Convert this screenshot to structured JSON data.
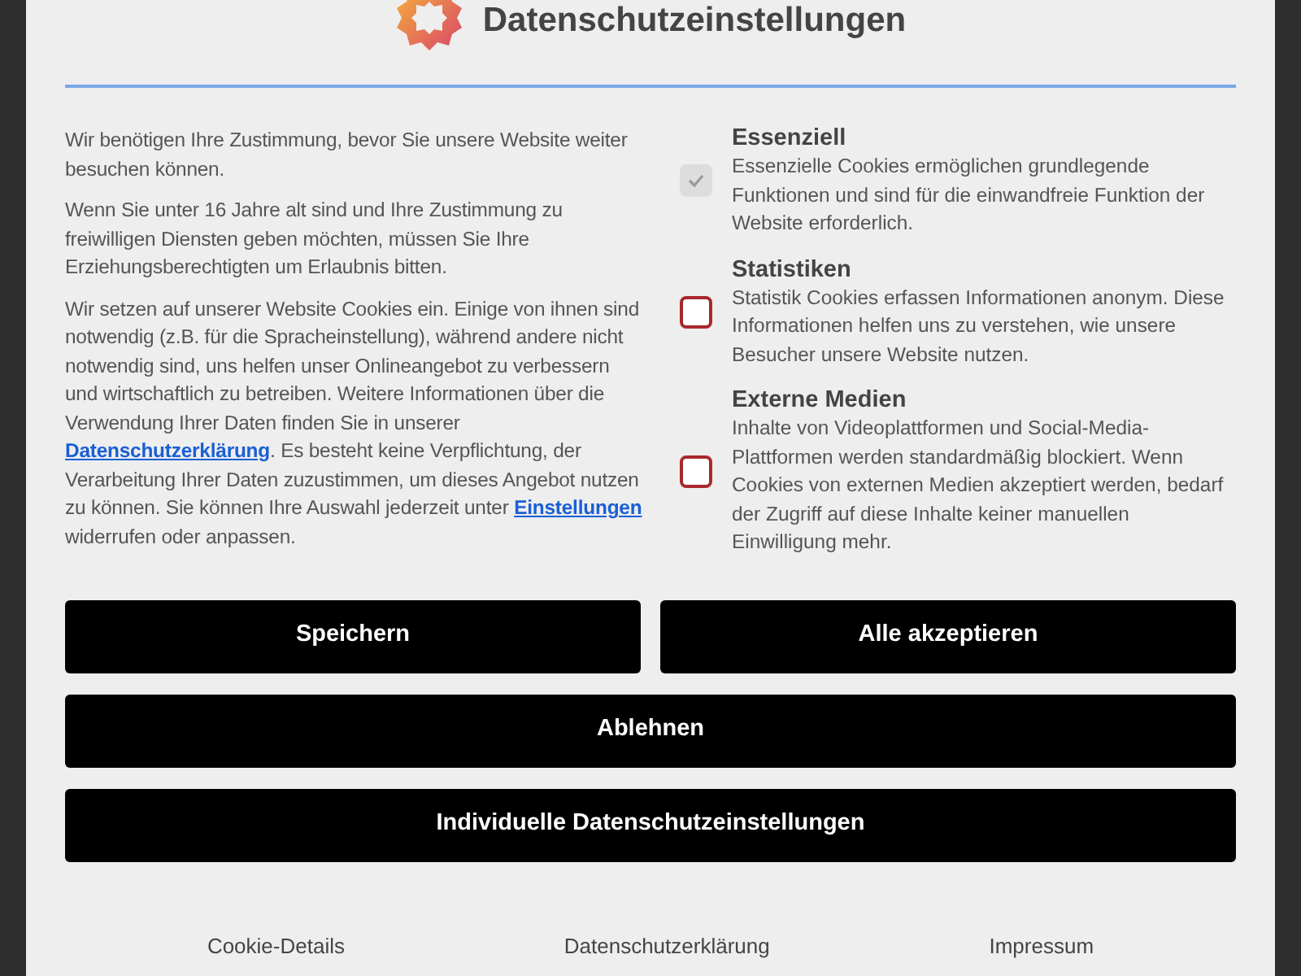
{
  "dialog": {
    "title": "Datenschutzeinstellungen",
    "intro": [
      "Wir benötigen Ihre Zustimmung, bevor Sie unsere Website weiter besuchen können.",
      "Wenn Sie unter 16 Jahre alt sind und Ihre Zustimmung zu freiwilligen Diensten geben möchten, müssen Sie Ihre Erziehungsberechtigten um Erlaubnis bitten."
    ],
    "notice": {
      "part_1": "Wir setzen auf unserer Website Cookies ein. Einige von ihnen sind notwendig (z.B. für die Spracheinstellung), während andere nicht notwendig sind, uns helfen unser Onlineangebot zu verbessern und wirtschaftlich zu betreiben. Weitere Informationen über die Verwendung Ihrer Daten finden Sie in unserer",
      "link_1": "Datenschutzerklärung",
      "part_2": ". Es besteht keine Verpflichtung, der Verarbeitung Ihrer Daten zuzustimmen, um dieses Angebot nutzen zu können. Sie können Ihre Auswahl jederzeit unter",
      "link_2": "Einstellungen",
      "part_3": "widerrufen oder anpassen."
    },
    "categories": [
      {
        "title": "Essenziell",
        "description": "Essenzielle Cookies ermöglichen grundlegende Funktionen und sind für die einwandfreie Funktion der Website erforderlich.",
        "checked": true,
        "disabled": true
      },
      {
        "title": "Statistiken",
        "description": "Statistik Cookies erfassen Informationen anonym. Diese Informationen helfen uns zu verstehen, wie unsere Besucher unsere Website nutzen.",
        "checked": false,
        "disabled": false
      },
      {
        "title": "Externe Medien",
        "description": "Inhalte von Videoplattformen und Social-Media-Plattformen werden standardmäßig blockiert. Wenn Cookies von externen Medien akzeptiert werden, bedarf der Zugriff auf diese Inhalte keiner manuellen Einwilligung mehr.",
        "checked": false,
        "disabled": false
      }
    ],
    "buttons": [
      "Speichern",
      "Alle akzeptieren",
      "Ablehnen",
      "Individuelle Datenschutzeinstellungen"
    ],
    "footer_links": [
      "Cookie-Details",
      "Datenschutzerklärung",
      "Impressum"
    ]
  }
}
